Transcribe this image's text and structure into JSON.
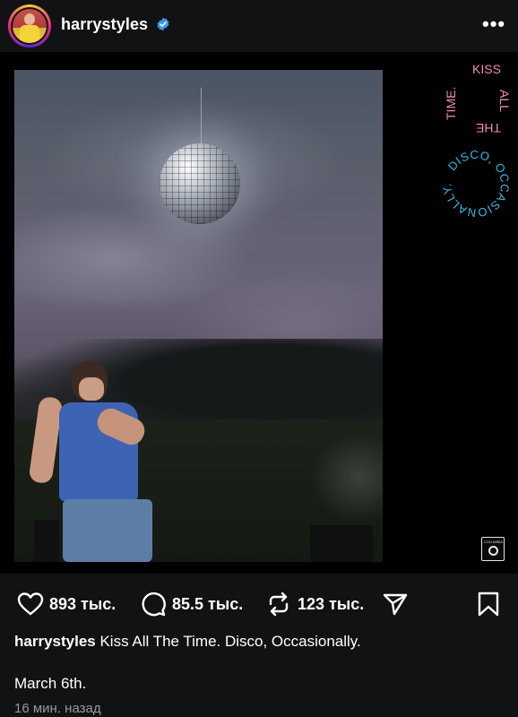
{
  "post": {
    "author": {
      "username": "harrystyles",
      "verified": true,
      "avatar_icon": "profile-avatar"
    },
    "more_icon": "ellipsis-icon",
    "more_label": "•••",
    "media": {
      "sticker_top_text": [
        "KISS",
        "ALL",
        "THE",
        "TIME."
      ],
      "sticker_bottom_text": "DISCO, OCCASIONALLY.",
      "label_logo": "COLUMBIA"
    },
    "actions": {
      "likes": "893 тыс.",
      "comments": "85.5 тыс.",
      "reposts": "123 тыс.",
      "share_icon": "send-icon",
      "save_icon": "bookmark-icon"
    },
    "caption": {
      "username": "harrystyles",
      "text": "Kiss All The Time. Disco, Occasionally."
    },
    "date_line": "March 6th.",
    "timestamp": "16 мин. назад"
  },
  "colors": {
    "background": "#111214",
    "verified_blue": "#3897f0",
    "sticker_pink": "#f08ab8",
    "sticker_blue": "#3fb7e6"
  }
}
